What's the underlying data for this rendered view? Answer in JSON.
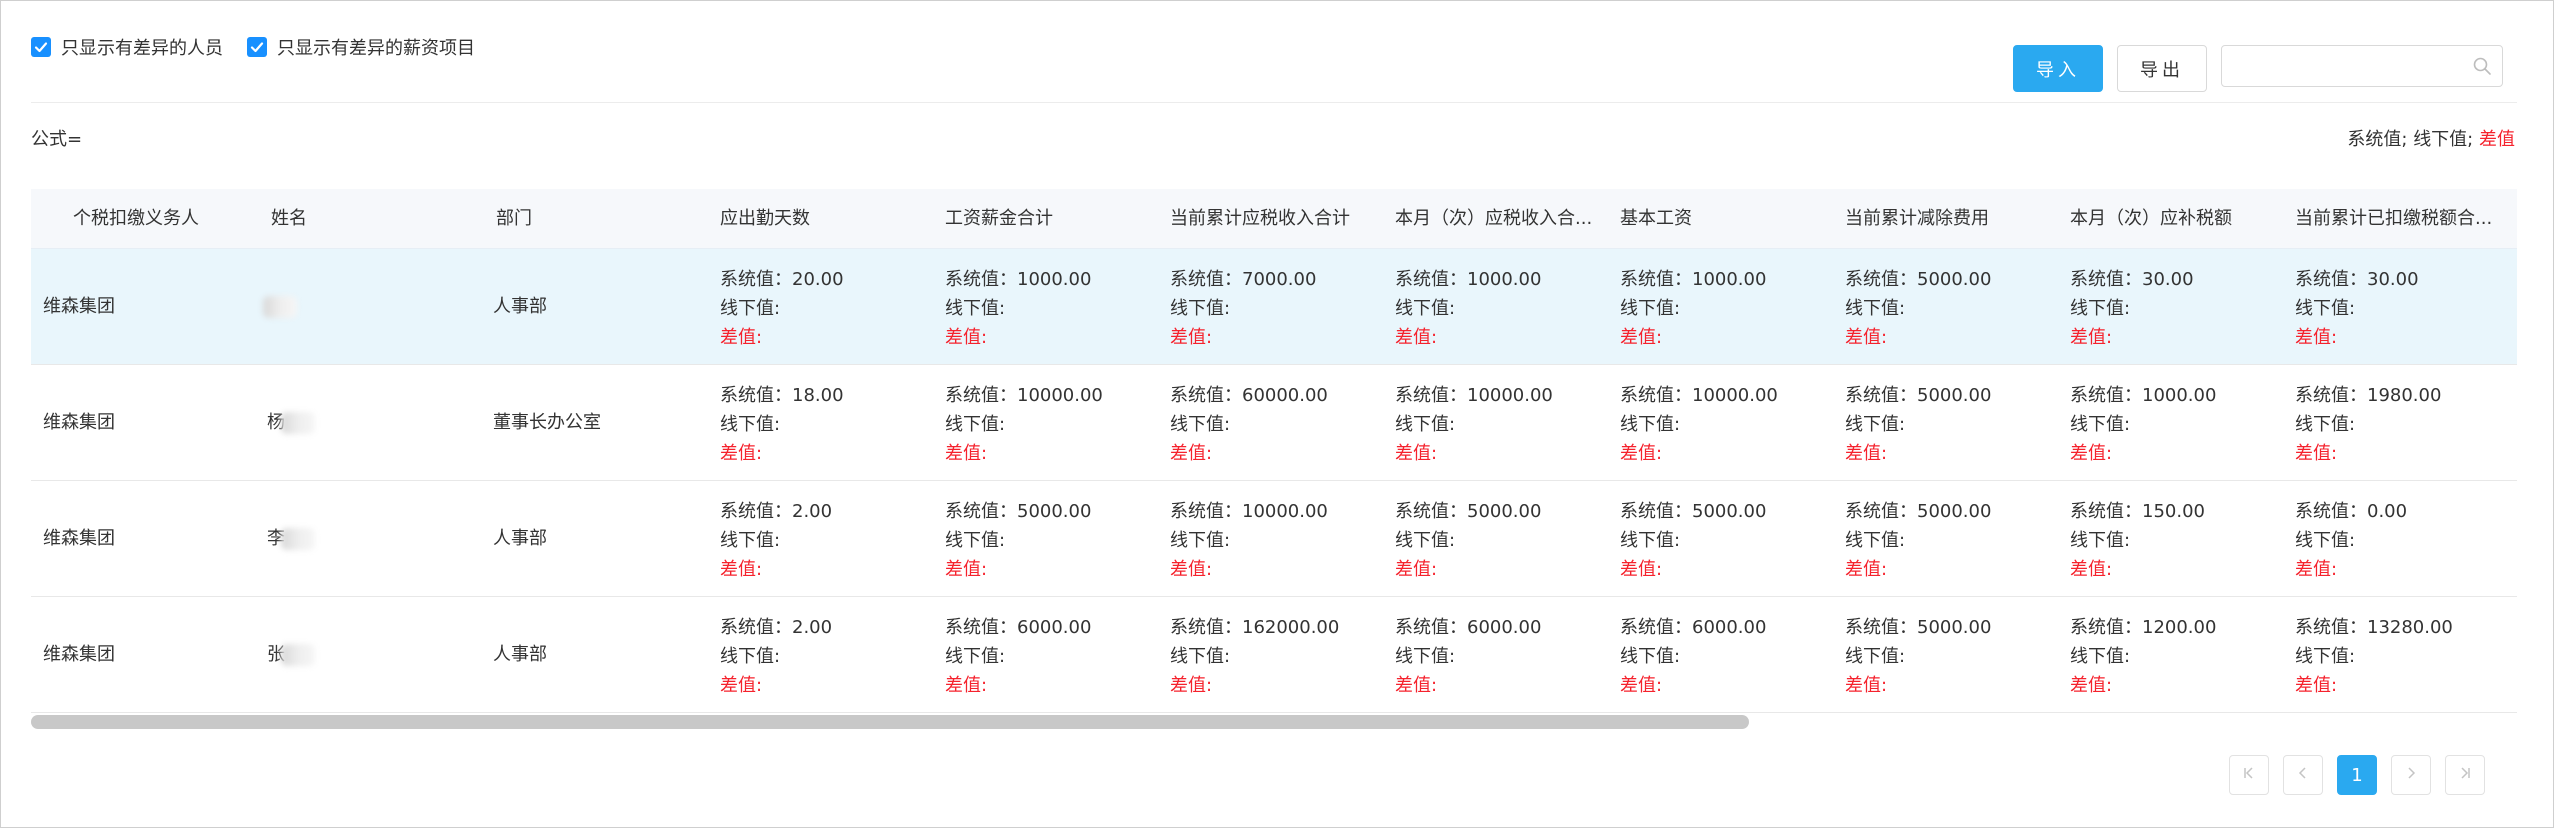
{
  "filters": {
    "only_diff_people": "只显示有差异的人员",
    "only_diff_items": "只显示有差异的薪资项目"
  },
  "toolbar": {
    "import_label": "导入",
    "export_label": "导出",
    "search_placeholder": ""
  },
  "formula": {
    "label": "公式="
  },
  "legend": {
    "system": "系统值;",
    "offline": "线下值;",
    "diff": "差值"
  },
  "labels": {
    "system_prefix": "系统值：",
    "offline_prefix": "线下值:",
    "diff_prefix": "差值:"
  },
  "table": {
    "columns": [
      "个税扣缴义务人",
      "姓名",
      "部门",
      "应出勤天数",
      "工资薪金合计",
      "当前累计应税收入合计",
      "本月（次）应税收入合...",
      "基本工资",
      "当前累计减除费用",
      "本月（次）应补税额",
      "当前累计已扣缴税额合..."
    ],
    "rows": [
      {
        "payer": "维森集团",
        "name": "",
        "dept": "人事部",
        "values": [
          "20.00",
          "1000.00",
          "7000.00",
          "1000.00",
          "1000.00",
          "5000.00",
          "30.00",
          "30.00"
        ]
      },
      {
        "payer": "维森集团",
        "name": "杨",
        "dept": "董事长办公室",
        "values": [
          "18.00",
          "10000.00",
          "60000.00",
          "10000.00",
          "10000.00",
          "5000.00",
          "1000.00",
          "1980.00"
        ]
      },
      {
        "payer": "维森集团",
        "name": "李",
        "dept": "人事部",
        "values": [
          "2.00",
          "5000.00",
          "10000.00",
          "5000.00",
          "5000.00",
          "5000.00",
          "150.00",
          "0.00"
        ]
      },
      {
        "payer": "维森集团",
        "name": "张",
        "dept": "人事部",
        "values": [
          "2.00",
          "6000.00",
          "162000.00",
          "6000.00",
          "6000.00",
          "5000.00",
          "1200.00",
          "13280.00"
        ]
      }
    ]
  },
  "pagination": {
    "current": "1"
  },
  "colors": {
    "accent": "#2aa9f0",
    "checkbox": "#1890ff",
    "diff": "#f5222d",
    "row_highlight": "#e9f6fc"
  },
  "icons": [
    "check-icon",
    "search-icon",
    "first-page-icon",
    "prev-page-icon",
    "next-page-icon",
    "last-page-icon"
  ]
}
